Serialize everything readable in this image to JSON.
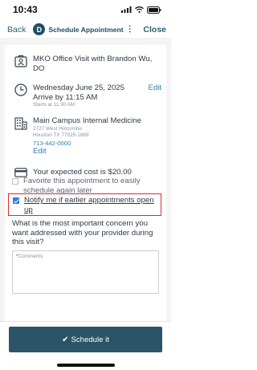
{
  "status_bar": {
    "time": "10:43",
    "icons": [
      "signal-icon",
      "wifi-icon",
      "battery-icon"
    ]
  },
  "nav": {
    "back_label": "Back",
    "avatar_initial": "D",
    "title": "Schedule Appointment",
    "more_label": "⋮",
    "close_label": "Close"
  },
  "visit": {
    "title": "MKO Office Visit with Brandon Wu, DO",
    "icon": "doctor-icon"
  },
  "time_info": {
    "date": "Wednesday June 25, 2025",
    "edit_label": "Edit",
    "arrive": "Arrive by 11:15 AM",
    "starts": "Starts at 11:30 AM",
    "icon": "clock-icon"
  },
  "location": {
    "name": "Main Campus Internal Medicine",
    "address_line1": "2727 West Holcombe",
    "address_line2": "Houston TX 77025-1669",
    "phone": "713-442-0000",
    "edit_label": "Edit",
    "icon": "building-icon"
  },
  "cost": {
    "text": "Your expected cost is $20.00",
    "icon": "credit-card-icon"
  },
  "favorite": {
    "label": "Favorite this appointment to easily schedule again later",
    "checked": false
  },
  "notify": {
    "label": "Notify me if earlier appointments open up",
    "checked": true,
    "highlight_color": "#e0282e"
  },
  "question": {
    "text": "What is the most important concern you want addressed with your provider during this visit?",
    "required_mark": "*",
    "placeholder": "Comments"
  },
  "footer": {
    "check_glyph": "✔",
    "button_label": "Schedule it"
  },
  "colors": {
    "primary": "#2b5566",
    "link": "#2a7fb3",
    "nav_text": "#2d5f73"
  }
}
